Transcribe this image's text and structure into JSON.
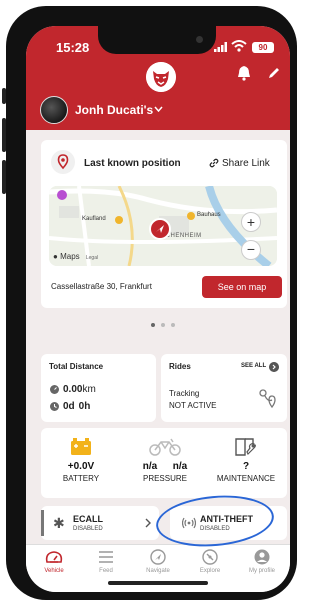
{
  "status": {
    "time": "15:28",
    "battery": "90"
  },
  "header": {
    "user_name": "Jonh Ducati's"
  },
  "position": {
    "title": "Last known position",
    "share_label": "Share Link",
    "map_places": [
      "Kaufland",
      "Bauhaus",
      "FECHENHEIM"
    ],
    "maps_brand": "Maps",
    "maps_legal": "Legal",
    "address": "Cassellastraße 30, Frankfurt",
    "see_on_map": "See on map"
  },
  "distance": {
    "title": "Total Distance",
    "km_value": "0.00",
    "km_unit": "km",
    "days_value": "0d",
    "hours_value": "0h"
  },
  "rides": {
    "title": "Rides",
    "see_all": "SEE ALL",
    "tracking_label": "Tracking",
    "tracking_status": "NOT ACTIVE"
  },
  "metrics": {
    "battery_value": "+0.0V",
    "battery_label": "BATTERY",
    "pressure_front": "n/a",
    "pressure_rear": "n/a",
    "pressure_label": "PRESSURE",
    "maintenance_value": "?",
    "maintenance_label": "MAINTENANCE"
  },
  "ecall": {
    "title": "ECALL",
    "status": "DISABLED"
  },
  "antitheft": {
    "title": "ANTI-THEFT",
    "status": "DISABLED"
  },
  "tabs": [
    {
      "label": "Vehicle",
      "icon": "speedometer-icon",
      "active": true
    },
    {
      "label": "Feed",
      "icon": "list-icon",
      "active": false
    },
    {
      "label": "Navigate",
      "icon": "navigate-icon",
      "active": false
    },
    {
      "label": "Explore",
      "icon": "compass-icon",
      "active": false
    },
    {
      "label": "My profile",
      "icon": "person-icon",
      "active": false
    }
  ],
  "colors": {
    "brand_red": "#c1272d",
    "highlight_blue": "#2a66d6"
  }
}
